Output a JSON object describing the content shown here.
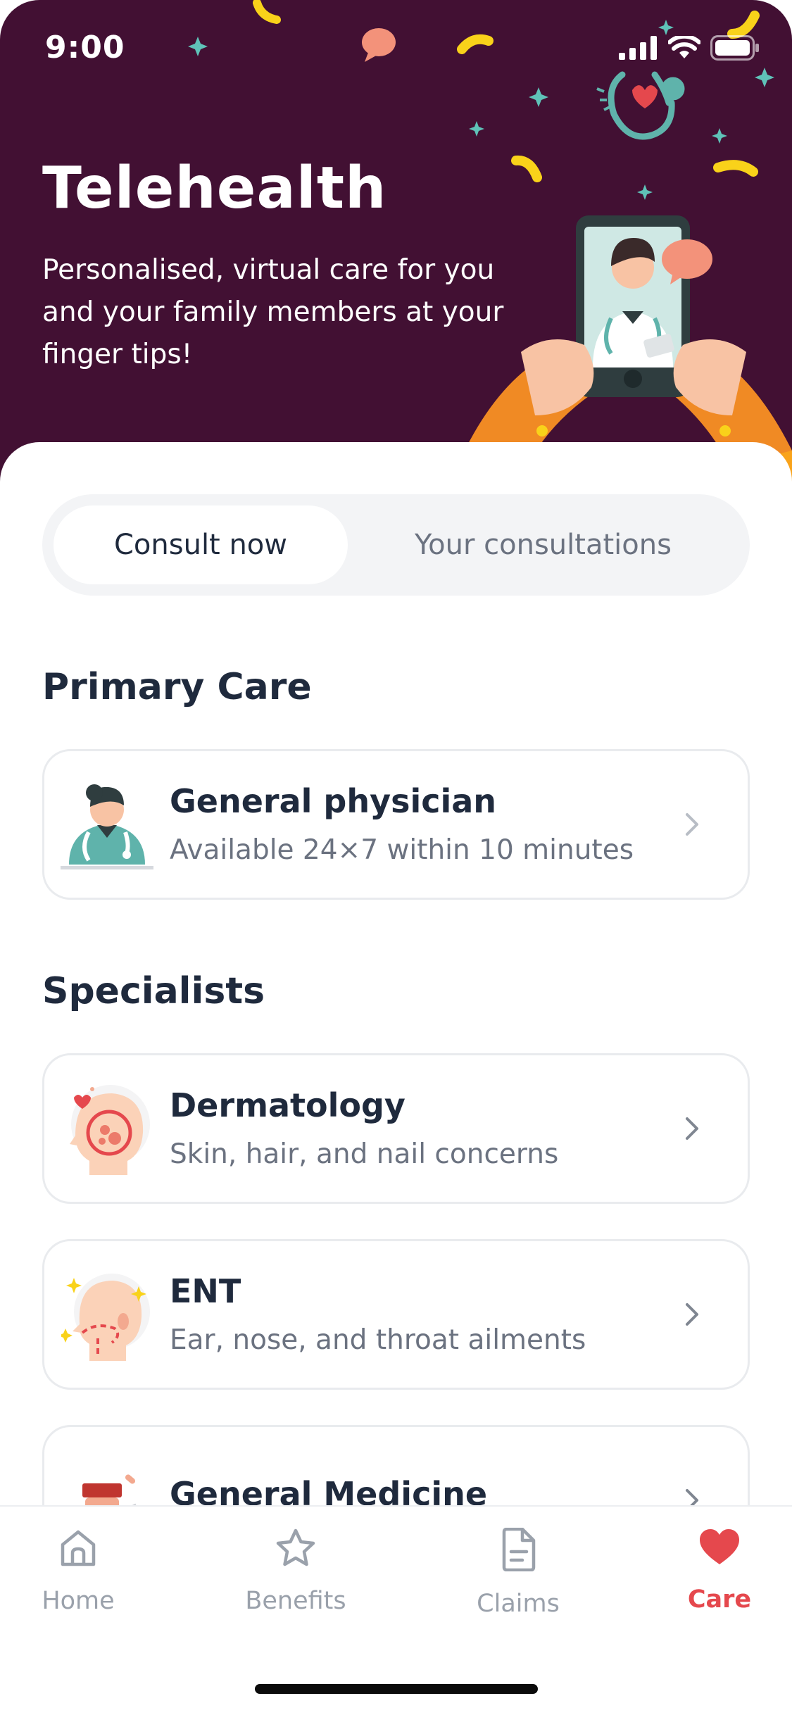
{
  "status_bar": {
    "time": "9:00"
  },
  "header": {
    "title": "Telehealth",
    "subtitle": "Personalised, virtual care for you and your family members at your finger tips!"
  },
  "tabs": {
    "consult_now": "Consult now",
    "your_consultations": "Your consultations",
    "active": "consult_now"
  },
  "primary_care": {
    "heading": "Primary Care",
    "items": [
      {
        "title": "General physician",
        "subtitle": "Available 24×7 within 10 minutes",
        "icon": "doctor-icon"
      }
    ]
  },
  "specialists": {
    "heading": "Specialists",
    "items": [
      {
        "title": "Dermatology",
        "subtitle": "Skin, hair, and nail concerns",
        "icon": "dermatology-icon"
      },
      {
        "title": "ENT",
        "subtitle": "Ear, nose, and throat ailments",
        "icon": "ent-icon"
      },
      {
        "title": "General Medicine",
        "subtitle": "",
        "icon": "medicine-icon"
      }
    ]
  },
  "nav": {
    "items": [
      {
        "label": "Home",
        "icon": "home-icon"
      },
      {
        "label": "Benefits",
        "icon": "star-icon"
      },
      {
        "label": "Claims",
        "icon": "document-icon"
      },
      {
        "label": "Care",
        "icon": "heart-icon"
      }
    ],
    "active": "Care"
  },
  "colors": {
    "header_bg": "#421033",
    "text_primary": "#1f2a3d",
    "text_secondary": "#6b7280",
    "accent_active": "#e5484d",
    "teal": "#5fb3ab",
    "orange": "#f08a24",
    "yellow": "#f9d21a"
  }
}
